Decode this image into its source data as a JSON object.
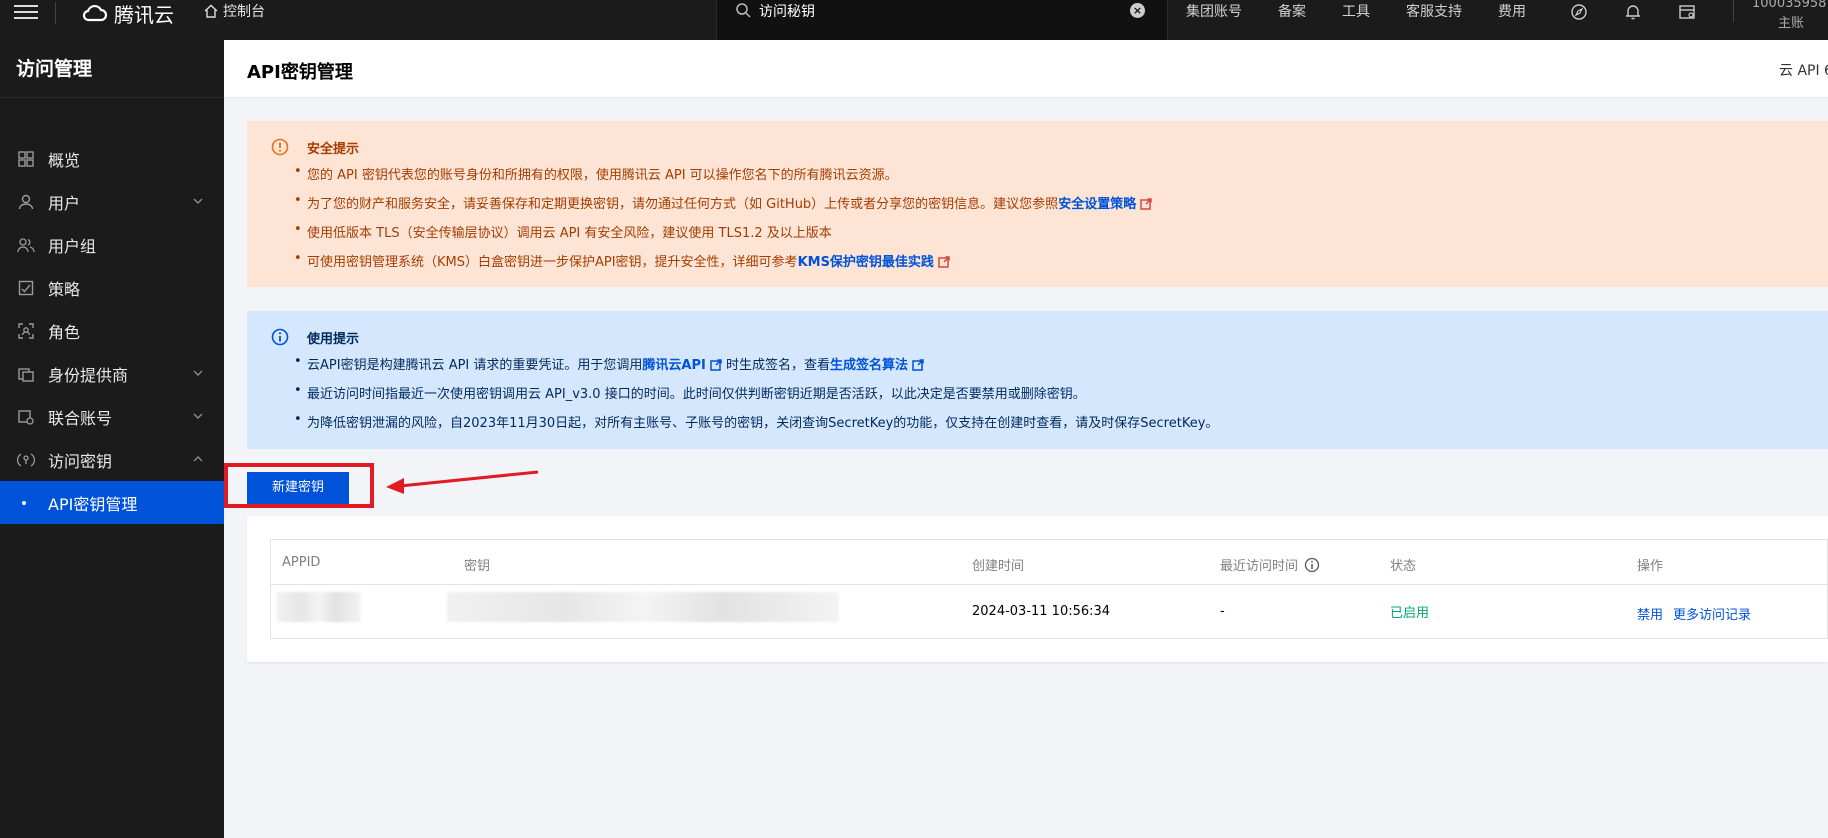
{
  "topbar": {
    "brand": "腾讯云",
    "console": "控制台",
    "search_value": "访问秘钥",
    "nav": [
      "集团账号",
      "备案",
      "工具",
      "客服支持",
      "费用"
    ],
    "account_id": "100035958",
    "account_role": "主账"
  },
  "sidebar": {
    "title": "访问管理",
    "items": [
      {
        "label": "概览"
      },
      {
        "label": "用户"
      },
      {
        "label": "用户组"
      },
      {
        "label": "策略"
      },
      {
        "label": "角色"
      },
      {
        "label": "身份提供商"
      },
      {
        "label": "联合账号"
      },
      {
        "label": "访问密钥"
      },
      {
        "label": "API密钥管理"
      }
    ]
  },
  "page": {
    "title": "API密钥管理",
    "right_link": "云 API 6"
  },
  "security_notice": {
    "title": "安全提示",
    "b1": "您的 API 密钥代表您的账号身份和所拥有的权限，使用腾讯云 API 可以操作您名下的所有腾讯云资源。",
    "b2_text": "为了您的财产和服务安全，请妥善保存和定期更换密钥，请勿通过任何方式（如 GitHub）上传或者分享您的密钥信息。建议您参照",
    "b2_link": "安全设置策略",
    "b3": "使用低版本 TLS（安全传输层协议）调用云 API 有安全风险，建议使用 TLS1.2 及以上版本",
    "b4_text": "可使用密钥管理系统（KMS）白盒密钥进一步保护API密钥，提升安全性，详细可参考",
    "b4_link": "KMS保护密钥最佳实践"
  },
  "usage_notice": {
    "title": "使用提示",
    "b1_a": "云API密钥是构建腾讯云 API 请求的重要凭证。用于您调用",
    "b1_link1": "腾讯云API",
    "b1_b": "时生成签名，查看",
    "b1_link2": "生成签名算法",
    "b2": "最近访问时间指最近一次使用密钥调用云 API_v3.0 接口的时间。此时间仅供判断密钥近期是否活跃，以此决定是否要禁用或删除密钥。",
    "b3": "为降低密钥泄漏的风险，自2023年11月30日起，对所有主账号、子账号的密钥，关闭查询SecretKey的功能，仅支持在创建时查看，请及时保存SecretKey。"
  },
  "create_button": "新建密钥",
  "table": {
    "headers": [
      "APPID",
      "密钥",
      "创建时间",
      "最近访问时间",
      "状态",
      "操作"
    ],
    "rows": [
      {
        "created": "2024-03-11 10:56:34",
        "last_access": "-",
        "status": "已启用",
        "actions": [
          "禁用",
          "更多访问记录"
        ]
      }
    ]
  },
  "colors": {
    "primary": "#0052d9",
    "topbar": "#1b1b1b",
    "warn_bg": "#fde4d5",
    "info_bg": "#d5e7fd",
    "success": "#00a870",
    "annotation": "#e01b24"
  }
}
